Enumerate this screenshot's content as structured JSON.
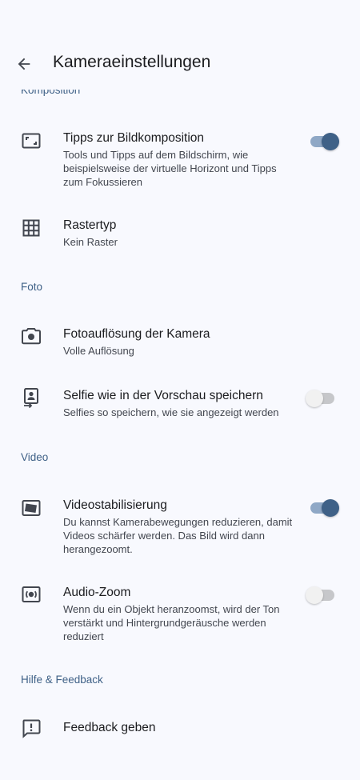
{
  "header": {
    "title": "Kameraeinstellungen",
    "back_icon": "arrow-back-icon"
  },
  "sections": {
    "komposition": "Komposition",
    "foto": "Foto",
    "video": "Video",
    "hilfe": "Hilfe & Feedback"
  },
  "settings": {
    "composition_tips": {
      "title": "Tipps zur Bildkomposition",
      "subtitle": "Tools und Tipps auf dem Bildschirm, wie beispielsweise der virtuelle Horizont und Tipps zum Fokussieren",
      "icon": "frame-corners-icon",
      "toggle_on": true
    },
    "grid_type": {
      "title": "Rastertyp",
      "subtitle": "Kein Raster",
      "icon": "grid-icon"
    },
    "photo_resolution": {
      "title": "Fotoauflösung der Kamera",
      "subtitle": "Volle Auflösung",
      "icon": "camera-icon"
    },
    "selfie_preview": {
      "title": "Selfie wie in der Vorschau speichern",
      "subtitle": "Selfies so speichern, wie sie angezeigt werden",
      "icon": "selfie-save-icon",
      "toggle_on": false
    },
    "video_stabilization": {
      "title": "Videostabilisierung",
      "subtitle": "Du kannst Kamerabewegungen reduzieren, damit Videos schärfer werden. Das Bild wird dann herangezoomt.",
      "icon": "video-stabilization-icon",
      "toggle_on": true
    },
    "audio_zoom": {
      "title": "Audio-Zoom",
      "subtitle": "Wenn du ein Objekt heranzoomst, wird der Ton verstärkt und Hintergrundgeräusche werden reduziert",
      "icon": "audio-zoom-icon",
      "toggle_on": false
    },
    "feedback": {
      "title": "Feedback geben",
      "icon": "feedback-icon"
    }
  },
  "colors": {
    "accent": "#3f6187",
    "accent_track": "#8fa8c6",
    "background": "#f8f9fe",
    "text_primary": "#1b1c1f",
    "text_secondary": "#42464f"
  }
}
